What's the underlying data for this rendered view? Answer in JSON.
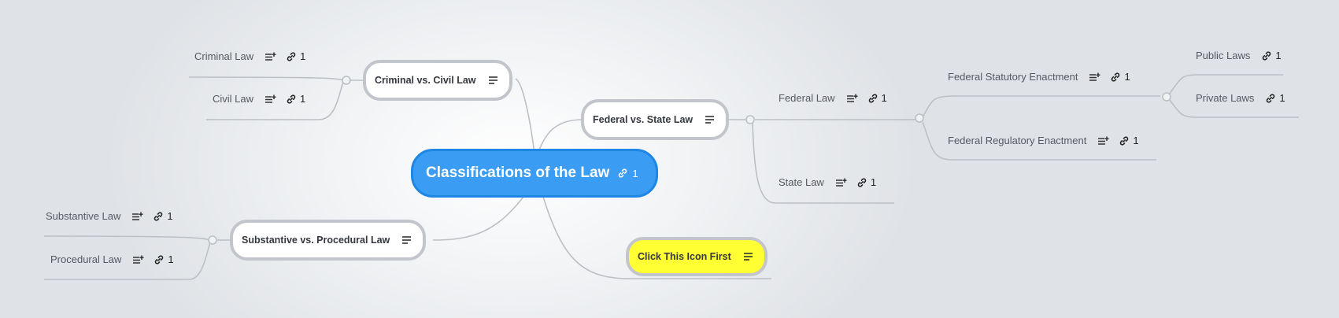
{
  "colors": {
    "root": "#3a9cf2",
    "highlight": "#ffff33",
    "line": "#bcc0c5"
  },
  "icons": {
    "note": "note-lines-plus-icon",
    "link": "chain-link-icon"
  },
  "root": {
    "label": "Classifications of the Law",
    "links": "1"
  },
  "branches": {
    "criminal_civil": {
      "label": "Criminal vs. Civil Law",
      "children": [
        {
          "label": "Criminal Law",
          "links": "1"
        },
        {
          "label": "Civil Law",
          "links": "1"
        }
      ]
    },
    "federal_state": {
      "label": "Federal vs. State Law",
      "federal": {
        "label": "Federal Law",
        "links": "1",
        "statutory": {
          "label": "Federal Statutory Enactment",
          "links": "1",
          "public": {
            "label": "Public Laws",
            "links": "1"
          },
          "private": {
            "label": "Private Laws",
            "links": "1"
          }
        },
        "regulatory": {
          "label": "Federal Regulatory Enactment",
          "links": "1"
        }
      },
      "state": {
        "label": "State Law",
        "links": "1"
      }
    },
    "substantive_procedural": {
      "label": "Substantive vs. Procedural Law",
      "children": [
        {
          "label": "Substantive Law",
          "links": "1"
        },
        {
          "label": "Procedural Law",
          "links": "1"
        }
      ]
    },
    "click_first": {
      "label": "Click This Icon First"
    }
  }
}
